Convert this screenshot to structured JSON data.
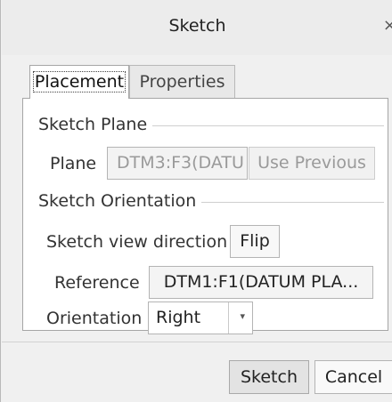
{
  "window": {
    "title": "Sketch",
    "close_glyph": "×"
  },
  "tabs": [
    {
      "label": "Placement",
      "active": true
    },
    {
      "label": "Properties",
      "active": false
    }
  ],
  "sketch_plane": {
    "group_label": "Sketch Plane",
    "plane_label": "Plane",
    "plane_value": "DTM3:F3(DATU",
    "use_previous_label": "Use Previous"
  },
  "sketch_orientation": {
    "group_label": "Sketch Orientation",
    "view_direction_label": "Sketch view direction",
    "flip_label": "Flip",
    "reference_label": "Reference",
    "reference_value": "DTM1:F1(DATUM PLA...",
    "orientation_label": "Orientation",
    "orientation_value": "Right"
  },
  "footer": {
    "sketch_label": "Sketch",
    "cancel_label": "Cancel"
  }
}
